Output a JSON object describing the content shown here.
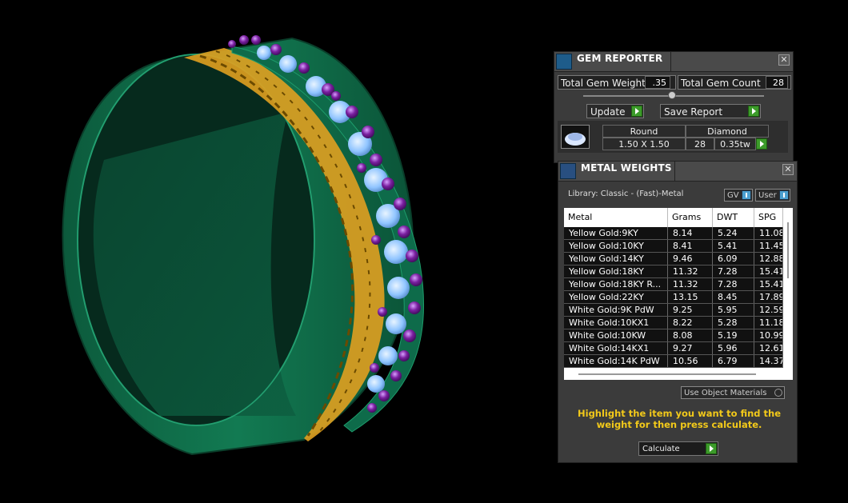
{
  "gem_reporter": {
    "title": "GEM REPORTER",
    "close_label": "✕",
    "total_gem_weight_label": "Total Gem Weight",
    "total_gem_weight_value": ".35",
    "total_gem_count_label": "Total Gem Count",
    "total_gem_count_value": "28",
    "update_label": "Update",
    "save_report_label": "Save Report",
    "gem_row": {
      "shape": "Round",
      "material": "Diamond",
      "size": "1.50 X 1.50",
      "count": "28",
      "weight": "0.35tw"
    }
  },
  "metal_weights": {
    "title": "METAL WEIGHTS",
    "close_label": "✕",
    "library_label": "Library: Classic - (Fast)-Metal",
    "gv_label": "GV",
    "user_label": "User",
    "columns": [
      "Metal",
      "Grams",
      "DWT",
      "SPG"
    ],
    "rows": [
      {
        "metal": "Yellow Gold:9KY",
        "grams": "8.14",
        "dwt": "5.24",
        "spg": "11.08"
      },
      {
        "metal": "Yellow Gold:10KY",
        "grams": "8.41",
        "dwt": "5.41",
        "spg": "11.45"
      },
      {
        "metal": "Yellow Gold:14KY",
        "grams": "9.46",
        "dwt": "6.09",
        "spg": "12.88"
      },
      {
        "metal": "Yellow Gold:18KY",
        "grams": "11.32",
        "dwt": "7.28",
        "spg": "15.41"
      },
      {
        "metal": "Yellow Gold:18KY R...",
        "grams": "11.32",
        "dwt": "7.28",
        "spg": "15.41"
      },
      {
        "metal": "Yellow Gold:22KY",
        "grams": "13.15",
        "dwt": "8.45",
        "spg": "17.89"
      },
      {
        "metal": "White Gold:9K PdW",
        "grams": "9.25",
        "dwt": "5.95",
        "spg": "12.59"
      },
      {
        "metal": "White Gold:10KX1",
        "grams": "8.22",
        "dwt": "5.28",
        "spg": "11.18"
      },
      {
        "metal": "White Gold:10KW",
        "grams": "8.08",
        "dwt": "5.19",
        "spg": "10.99"
      },
      {
        "metal": "White Gold:14KX1",
        "grams": "9.27",
        "dwt": "5.96",
        "spg": "12.61"
      },
      {
        "metal": "White Gold:14K PdW",
        "grams": "10.56",
        "dwt": "6.79",
        "spg": "14.37"
      }
    ],
    "use_object_materials_label": "Use Object Materials",
    "instruction_text": "Highlight the item you want to find the weight for then press calculate.",
    "calculate_label": "Calculate"
  },
  "colors": {
    "ring_green": "#0e6b4a",
    "gold_pattern": "#e0a020",
    "amethyst": "#7a1fa0",
    "diamond_blue": "#8fc4ff",
    "instruction_yellow": "#f2c91a"
  }
}
